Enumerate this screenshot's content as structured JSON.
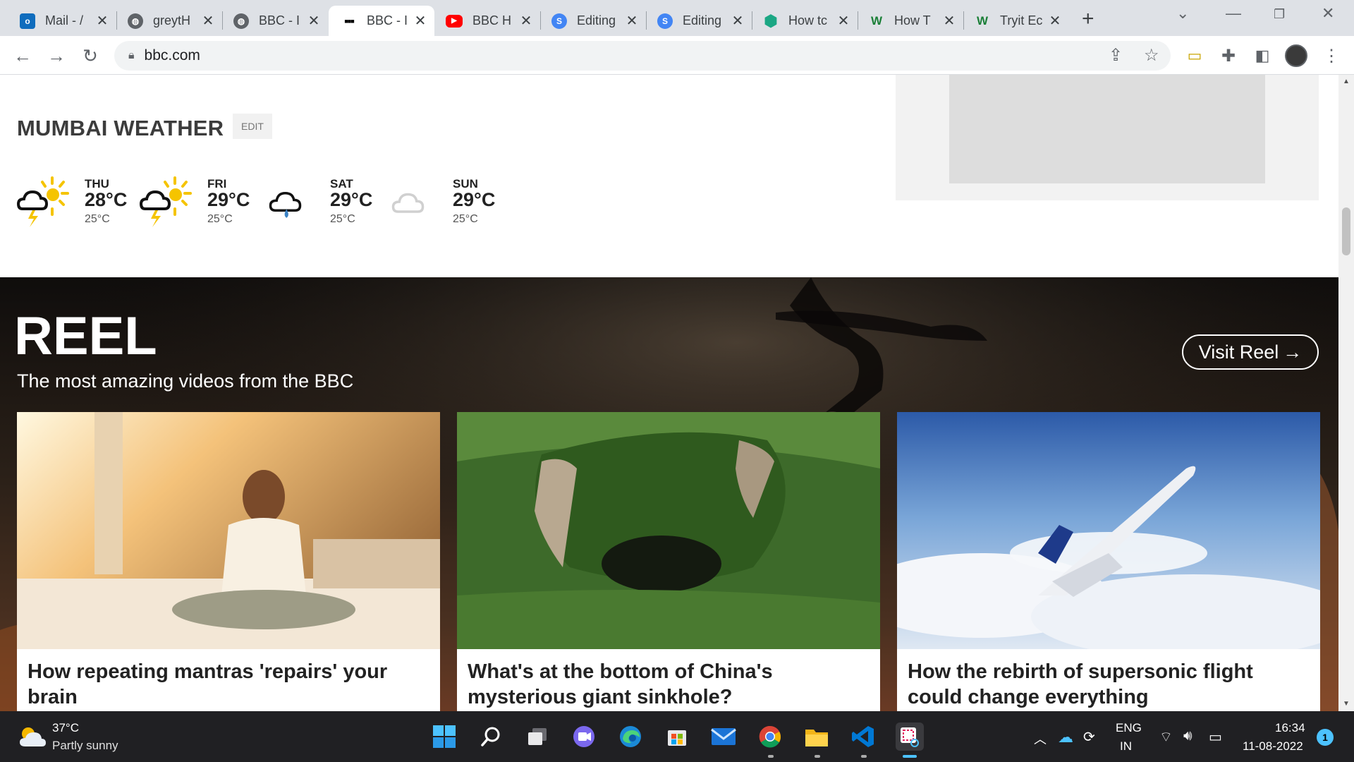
{
  "browser": {
    "tabs": [
      {
        "title": "Mail - /",
        "favicon": "outlook-icon",
        "color": "#0f6cbd",
        "glyph": "o"
      },
      {
        "title": "greytH",
        "favicon": "globe-icon",
        "color": "#5f6368",
        "glyph": "◍"
      },
      {
        "title": "BBC - I",
        "favicon": "globe-icon",
        "color": "#5f6368",
        "glyph": "◍"
      },
      {
        "title": "BBC - I",
        "favicon": "bbc-icon",
        "color": "#000000",
        "glyph": "■■■"
      },
      {
        "title": "BBC H",
        "favicon": "youtube-icon",
        "color": "#ff0000",
        "glyph": "▶"
      },
      {
        "title": "Editing",
        "favicon": "editor-icon",
        "color": "#4285f4",
        "glyph": "S"
      },
      {
        "title": "Editing",
        "favicon": "editor-icon",
        "color": "#4285f4",
        "glyph": "S"
      },
      {
        "title": "How tc",
        "favicon": "hexagon-icon",
        "color": "#1ba784",
        "glyph": "⬢"
      },
      {
        "title": "How T",
        "favicon": "w-icon",
        "color": "#1a7f37",
        "glyph": "W"
      },
      {
        "title": "Tryit Ec",
        "favicon": "w-icon",
        "color": "#1a7f37",
        "glyph": "W"
      }
    ],
    "active_tab_index": 3,
    "url": "bbc.com"
  },
  "weather": {
    "title": "MUMBAI WEATHER",
    "edit_label": "EDIT",
    "days": [
      {
        "day": "THU",
        "high": "28°C",
        "low": "25°C",
        "icon": "thunder-sun-icon"
      },
      {
        "day": "FRI",
        "high": "29°C",
        "low": "25°C",
        "icon": "thunder-sun-icon"
      },
      {
        "day": "SAT",
        "high": "29°C",
        "low": "25°C",
        "icon": "rain-cloud-icon"
      },
      {
        "day": "SUN",
        "high": "29°C",
        "low": "25°C",
        "icon": "cloud-icon"
      }
    ]
  },
  "reel": {
    "title": "REEL",
    "subtitle": "The most amazing videos from the BBC",
    "visit_label": "Visit Reel",
    "cards": [
      {
        "headline": "How repeating mantras 'repairs' your brain"
      },
      {
        "headline": "What's at the bottom of China's mysterious giant sinkhole?"
      },
      {
        "headline": "How the rebirth of supersonic flight could change everything"
      }
    ]
  },
  "taskbar": {
    "temperature": "37°C",
    "condition": "Partly sunny",
    "language": "ENG",
    "region": "IN",
    "time": "16:34",
    "date": "11-08-2022",
    "notifications": "1"
  },
  "colors": {
    "tabstrip": "#dee1e6",
    "taskbar": "#202023",
    "accent": "#4cc2ff"
  }
}
